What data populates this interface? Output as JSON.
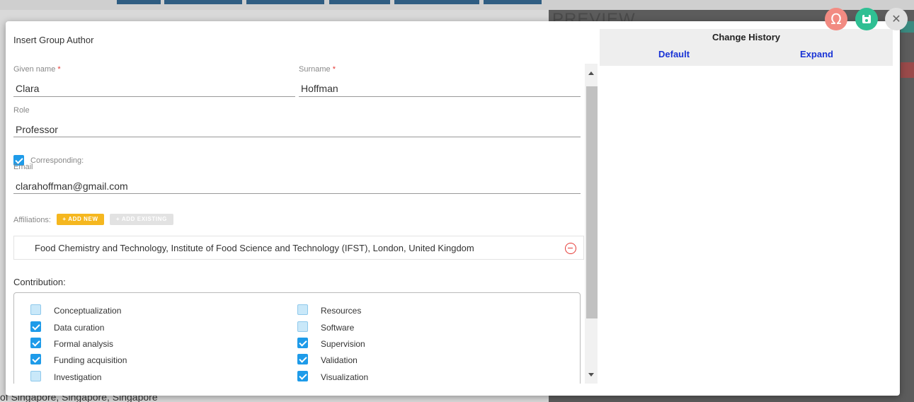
{
  "background": {
    "preview_heading": "PREVIEW",
    "bottom_text": "of Singapore, Singapore, Singapore"
  },
  "dialog": {
    "title": "Insert Group Author",
    "given_name": {
      "label": "Given name",
      "required_mark": "*",
      "value": "Clara"
    },
    "surname": {
      "label": "Surname",
      "required_mark": "*",
      "value": "Hoffman"
    },
    "role": {
      "label": "Role",
      "value": "Professor"
    },
    "corresponding": {
      "label": "Corresponding:",
      "checked": true
    },
    "email": {
      "label": "Email",
      "value": "clarahoffman@gmail.com"
    },
    "affiliations": {
      "label": "Affiliations:",
      "add_new_label": "+ ADD NEW",
      "add_existing_label": "+ ADD EXISTING",
      "items": [
        "Food Chemistry and Technology, Institute of Food Science and Technology (IFST), London, United Kingdom"
      ]
    },
    "contribution": {
      "label": "Contribution:",
      "left": [
        {
          "label": "Conceptualization",
          "checked": false
        },
        {
          "label": "Data curation",
          "checked": true
        },
        {
          "label": "Formal analysis",
          "checked": true
        },
        {
          "label": "Funding acquisition",
          "checked": true
        },
        {
          "label": "Investigation",
          "checked": false
        }
      ],
      "right": [
        {
          "label": "Resources",
          "checked": false
        },
        {
          "label": "Software",
          "checked": false
        },
        {
          "label": "Supervision",
          "checked": true
        },
        {
          "label": "Validation",
          "checked": true
        },
        {
          "label": "Visualization",
          "checked": true
        }
      ]
    }
  },
  "history": {
    "title": "Change History",
    "default_label": "Default",
    "expand_label": "Expand"
  },
  "actions": {
    "omega_glyph": "Ω",
    "close_glyph": "✕"
  },
  "colors": {
    "accent_blue": "#1e9be9",
    "add_new": "#f5b71f",
    "save_green": "#2fbf93",
    "omega_red": "#f28b82",
    "link_blue": "#1a34d6",
    "remove_red": "#e53935"
  }
}
